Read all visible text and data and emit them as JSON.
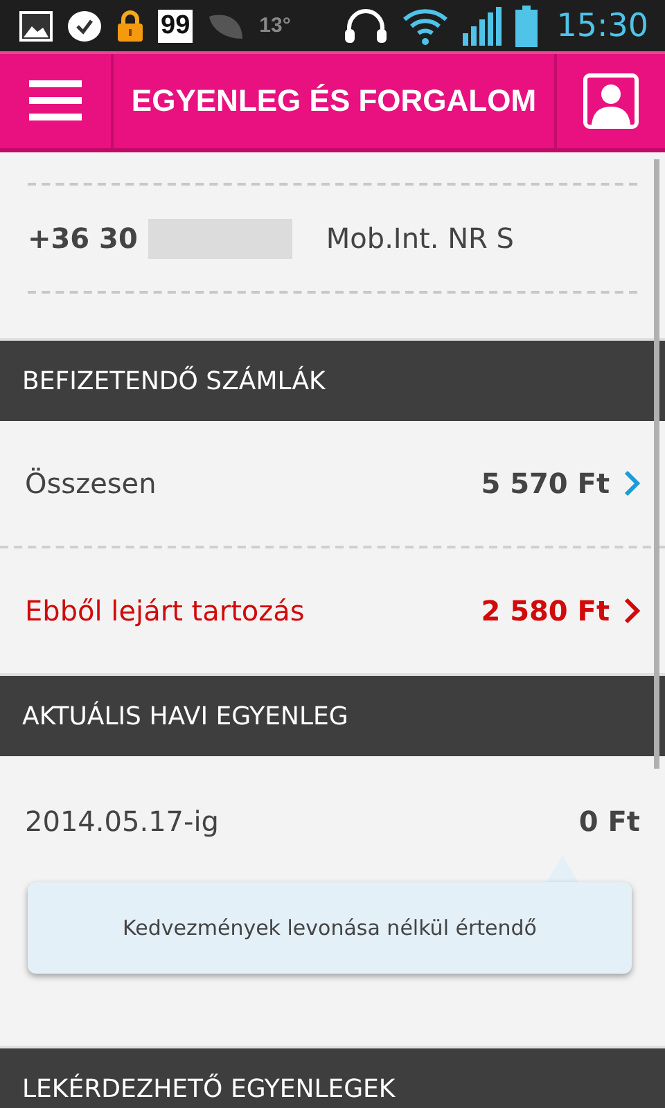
{
  "status_bar": {
    "badge": "99",
    "temperature": "13°",
    "time": "15:30"
  },
  "header": {
    "title": "EGYENLEG ÉS FORGALOM"
  },
  "account": {
    "phone_prefix": "+36 30",
    "plan": "Mob.Int. NR S"
  },
  "sections": [
    {
      "title": "BEFIZETENDŐ SZÁMLÁK",
      "rows": [
        {
          "kind": "normal",
          "label": "Összesen",
          "amount": "5 570 Ft"
        },
        {
          "kind": "overdue",
          "label": "Ebből lejárt tartozás",
          "amount": "2 580 Ft"
        }
      ]
    },
    {
      "title": "AKTUÁLIS HAVI EGYENLEG",
      "rows": [
        {
          "kind": "balance",
          "label": "2014.05.17-ig",
          "amount": "0 Ft"
        }
      ],
      "note": "Kedvezmények levonása nélkül értendő"
    },
    {
      "title": "LEKÉRDEZHETŐ EGYENLEGEK"
    }
  ]
}
